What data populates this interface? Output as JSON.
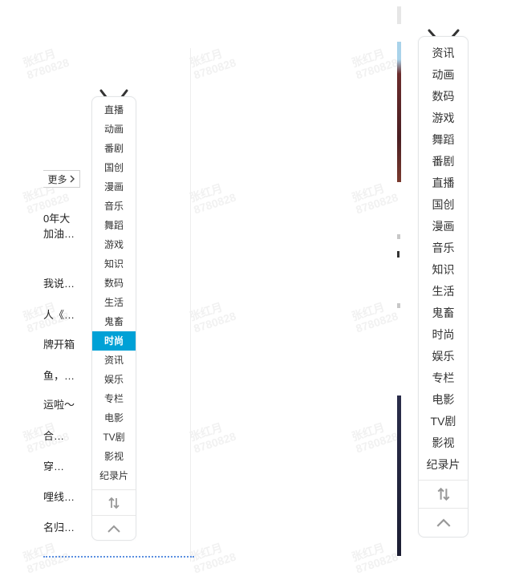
{
  "watermark": {
    "name": "张红月",
    "id": "8780828"
  },
  "left_panel": {
    "more_label": "更多",
    "feed_items": [
      "0年大",
      "加油…",
      "我说…",
      "人《…",
      "牌开箱",
      "鱼，…",
      "运啦～",
      "合…",
      "穿…",
      "哩线…",
      "名归…"
    ]
  },
  "nav_primary": {
    "items": [
      "直播",
      "动画",
      "番剧",
      "国创",
      "漫画",
      "音乐",
      "舞蹈",
      "游戏",
      "知识",
      "数码",
      "生活",
      "鬼畜",
      "时尚",
      "资讯",
      "娱乐",
      "专栏",
      "电影",
      "TV剧",
      "影视",
      "纪录片"
    ],
    "active": "时尚",
    "sort_icon": "sort-arrows-icon",
    "top_icon": "chevron-up-icon"
  },
  "nav_secondary": {
    "items": [
      "资讯",
      "动画",
      "数码",
      "游戏",
      "舞蹈",
      "番剧",
      "直播",
      "国创",
      "漫画",
      "音乐",
      "知识",
      "生活",
      "鬼畜",
      "时尚",
      "娱乐",
      "专栏",
      "电影",
      "TV剧",
      "影视",
      "纪录片"
    ],
    "sort_icon": "sort-arrows-icon",
    "top_icon": "chevron-up-icon"
  },
  "colors": {
    "active_bg": "#00a1d6",
    "border": "#e3e5e7",
    "link_dotted": "#5b8fe0"
  }
}
